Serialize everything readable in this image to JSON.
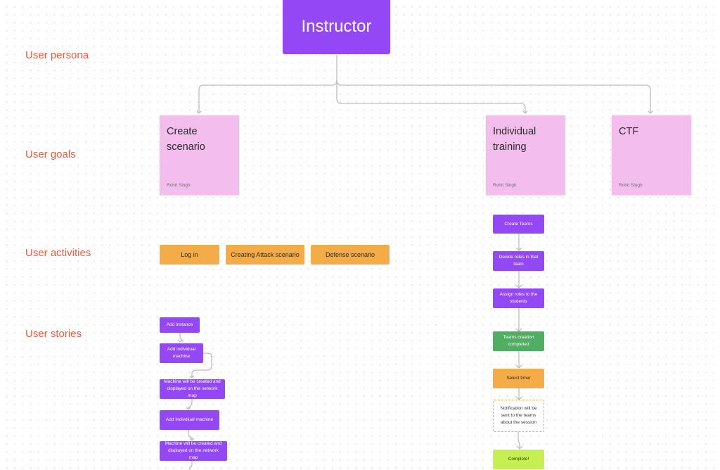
{
  "row_labels": {
    "persona": "User persona",
    "goals": "User goals",
    "activities": "User activities",
    "stories": "User stories"
  },
  "persona": {
    "label": "Instructor"
  },
  "goals": [
    {
      "title": "Create scenario",
      "author": "Rohit Singh"
    },
    {
      "title": "Individual training",
      "author": "Rohit Singh"
    },
    {
      "title": "CTF",
      "author": "Rohit Singh"
    }
  ],
  "activities": [
    "Log in",
    "Creating Attack scenario",
    "Defense scenario"
  ],
  "stories_left": [
    "Add instance",
    "Add individual machine",
    "Machine will be created and displayed on the network map",
    "Add Indivdiual machine",
    "Machine will be created and displayed on the network map"
  ],
  "stories_right": [
    "Create Teams",
    "Decide roles in that team",
    "Assign roles to the students",
    "Teams creation completed",
    "Select timer",
    "Notification will be sent to the teams about the session",
    "Complete!"
  ],
  "colors": {
    "persona": "#9448f5",
    "sticky": "#f3bdee",
    "activity": "#f3ac47",
    "label": "#ef5b3a",
    "success": "#4fae62",
    "complete": "#c6ef53",
    "connector": "#bdbdbd"
  }
}
